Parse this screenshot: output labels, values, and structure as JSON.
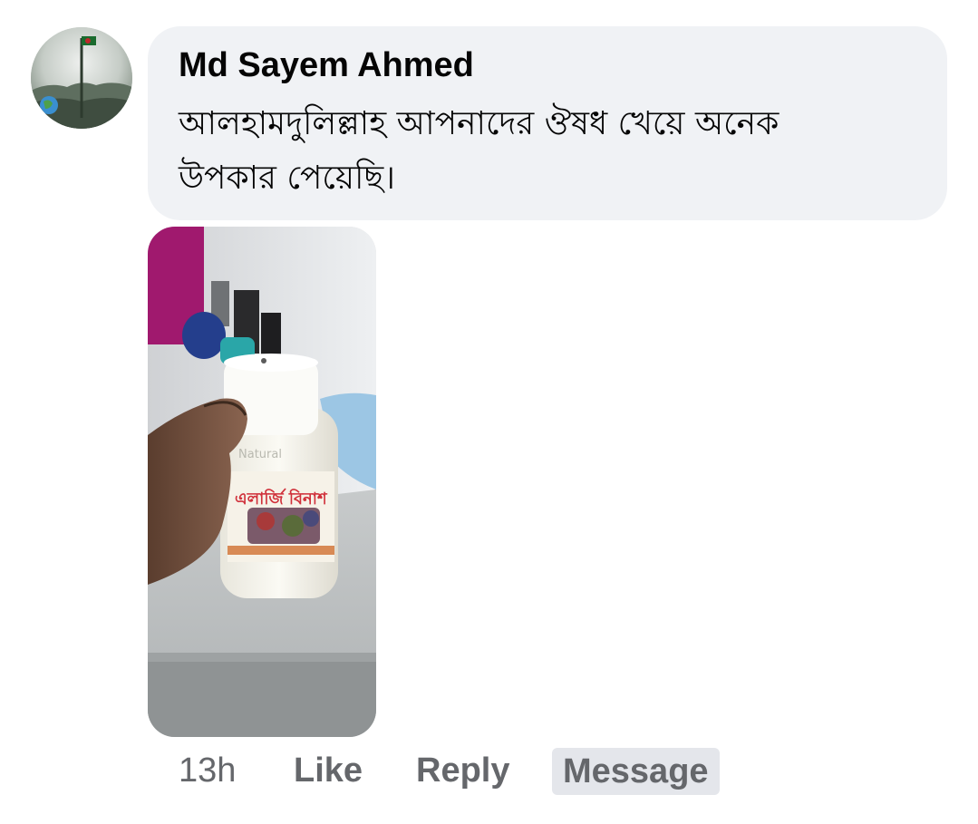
{
  "comment": {
    "author": "Md Sayem Ahmed",
    "text": "আলহামদুলিল্লাহ  আপনাদের ঔষধ খেয়ে অনেক উপকার পেয়েছি।",
    "photo": {
      "label_text": "এলার্জি বিনাশ",
      "label_brand": "Natural"
    }
  },
  "actions": {
    "time": "13h",
    "like": "Like",
    "reply": "Reply",
    "message": "Message"
  },
  "colors": {
    "bubble": "#f0f2f5",
    "text": "#050505",
    "secondary_text": "#65676b",
    "message_highlight": "#e4e6eb"
  }
}
